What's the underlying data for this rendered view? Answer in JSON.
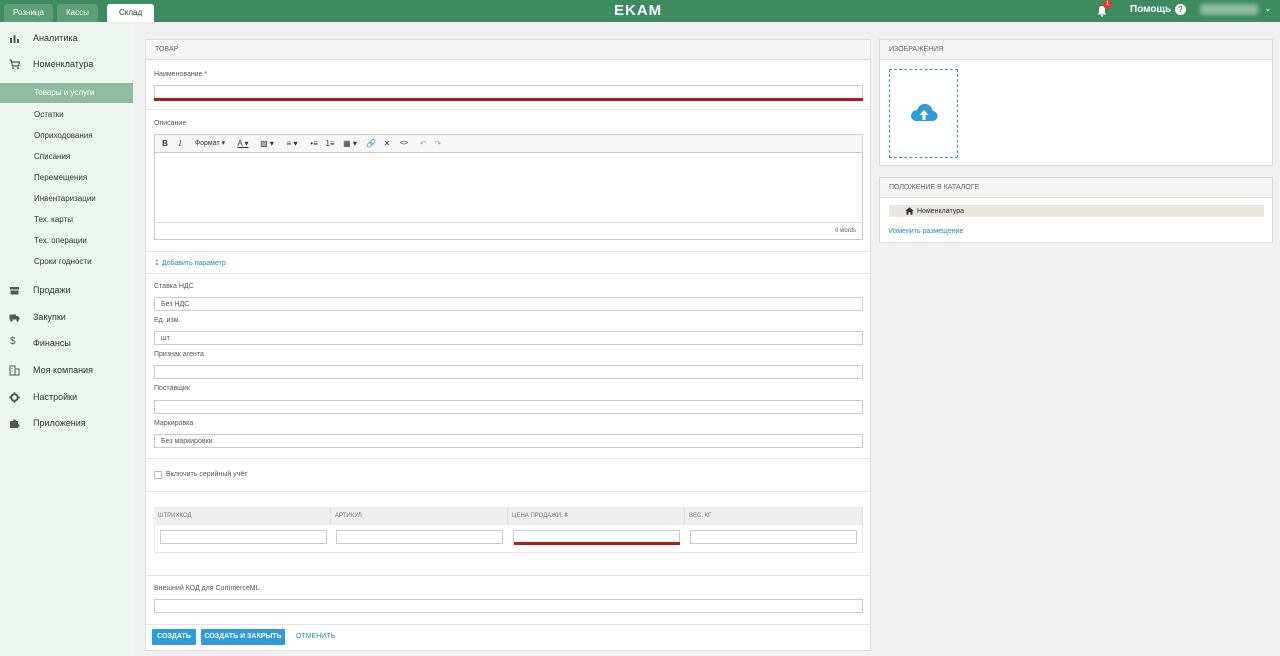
{
  "topbar": {
    "tabs": [
      {
        "label": "Розница"
      },
      {
        "label": "Кассы"
      },
      {
        "label": "Склад"
      }
    ],
    "logo": "EKAM",
    "notification_count": "1",
    "help_label": "Помощь",
    "help_icon": "?",
    "colors": {
      "brand": "#3d8b5e",
      "accent": "#2e9bd6"
    }
  },
  "sidebar": {
    "items": [
      {
        "label": "Аналитика",
        "icon": "bar-chart-icon"
      },
      {
        "label": "Номенклатура",
        "icon": "cart-icon"
      },
      {
        "label": "Продажи",
        "icon": "store-icon"
      },
      {
        "label": "Закупки",
        "icon": "truck-icon"
      },
      {
        "label": "Финансы",
        "icon": "dollar-icon"
      },
      {
        "label": "Моя компания",
        "icon": "building-icon"
      },
      {
        "label": "Настройки",
        "icon": "gear-icon"
      },
      {
        "label": "Приложения",
        "icon": "puzzle-icon"
      }
    ],
    "subitems": [
      {
        "label": "Товары и услуги"
      },
      {
        "label": "Остатки"
      },
      {
        "label": "Оприходования"
      },
      {
        "label": "Списания"
      },
      {
        "label": "Перемещения"
      },
      {
        "label": "Инвентаризации"
      },
      {
        "label": "Тех. карты"
      },
      {
        "label": "Тех. операции"
      },
      {
        "label": "Сроки годности"
      }
    ]
  },
  "form": {
    "section_title": "ТОВАР",
    "name_label": "Наименование *",
    "name_value": "",
    "description_label": "Описание",
    "editor": {
      "bold": "B",
      "italic": "I",
      "format": "Формат",
      "font_color": "A",
      "word_count": "0 words"
    },
    "add_param": "Добавить параметр",
    "vat_label": "Ставка НДС",
    "vat_value": "Без НДС",
    "unit_label": "Ед. изм.",
    "unit_value": "шт",
    "agent_label": "Признак агента",
    "agent_value": "",
    "supplier_label": "Поставщик",
    "supplier_value": "",
    "marking_label": "Маркировка",
    "marking_value": "Без маркировки",
    "serial_label": "Включить серийный учёт",
    "table": {
      "headers": [
        "ШТРИХКОД",
        "АРТИКУЛ",
        "ЦЕНА ПРОДАЖИ, ₴",
        "ВЕС, КГ"
      ]
    },
    "external_code_label": "Внешний КОД для CommerceML",
    "external_code_value": "",
    "buttons": {
      "create": "СОЗДАТЬ",
      "create_close": "СОЗДАТЬ И ЗАКРЫТЬ",
      "cancel": "ОТМЕНИТЬ"
    }
  },
  "images_panel": {
    "title": "ИЗОБРАЖЕНИЯ"
  },
  "catalog_panel": {
    "title": "ПОЛОЖЕНИЕ В КАТАЛОГЕ",
    "path": "Номенклатура",
    "change_link": "Изменить размещение"
  }
}
